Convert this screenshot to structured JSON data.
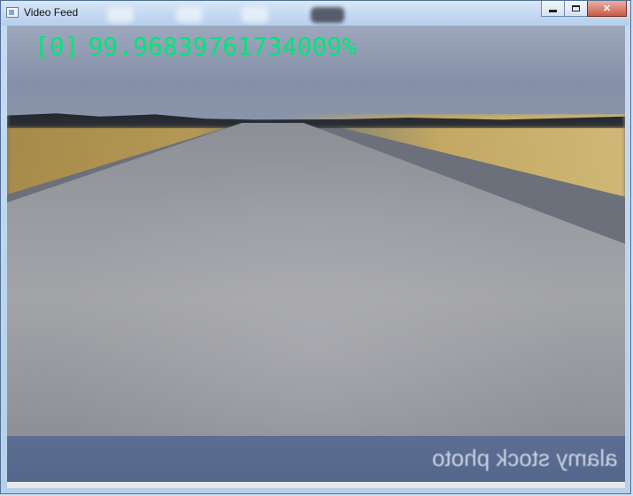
{
  "window": {
    "title": "Video Feed",
    "controls": {
      "minimize": "minimize",
      "maximize": "maximize",
      "close": "✕"
    }
  },
  "feed": {
    "class_index": "[0]",
    "confidence": "99.968397617340​09%",
    "overlay_color": "#00e676",
    "watermark": "alamy stock photo"
  }
}
